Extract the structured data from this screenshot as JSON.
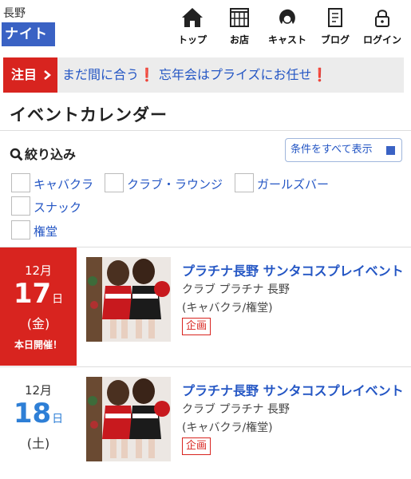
{
  "header": {
    "area_name": "長野",
    "night_label": "ナイト",
    "nav": [
      {
        "label": "トップ",
        "icon": "home-icon"
      },
      {
        "label": "お店",
        "icon": "shop-icon"
      },
      {
        "label": "キャスト",
        "icon": "cast-icon"
      },
      {
        "label": "ブログ",
        "icon": "blog-icon"
      },
      {
        "label": "ログイン",
        "icon": "lock-icon"
      }
    ]
  },
  "notice": {
    "tag": "注目",
    "text_before": "まだ間に合う",
    "text_middle": "忘年会はプライズにお任せ",
    "mark": "❗"
  },
  "section_title": "イベントカレンダー",
  "filter": {
    "title": "絞り込み",
    "show_all_label": "条件をすべて表示",
    "options": [
      "キャバクラ",
      "クラブ・ラウンジ",
      "ガールズバー",
      "スナック",
      "権堂"
    ]
  },
  "events": [
    {
      "month": "12月",
      "day": "17",
      "day_suffix": "日",
      "weekday": "(金)",
      "today_label": "本日開催！",
      "title": "プラチナ長野 サンタコスプレイベント",
      "shop": "クラブ プラチナ 長野",
      "category": "(キャバクラ/権堂)",
      "badge": "企画"
    },
    {
      "month": "12月",
      "day": "18",
      "day_suffix": "日",
      "weekday": "(土)",
      "today_label": "",
      "title": "プラチナ長野 サンタコスプレイベント",
      "shop": "クラブ プラチナ 長野",
      "category": "(キャバクラ/権堂)",
      "badge": "企画"
    }
  ],
  "colors": {
    "accent_blue": "#3a62c4",
    "link_blue": "#2456c4",
    "red": "#d8241f",
    "day_blue": "#2e7fd6"
  }
}
